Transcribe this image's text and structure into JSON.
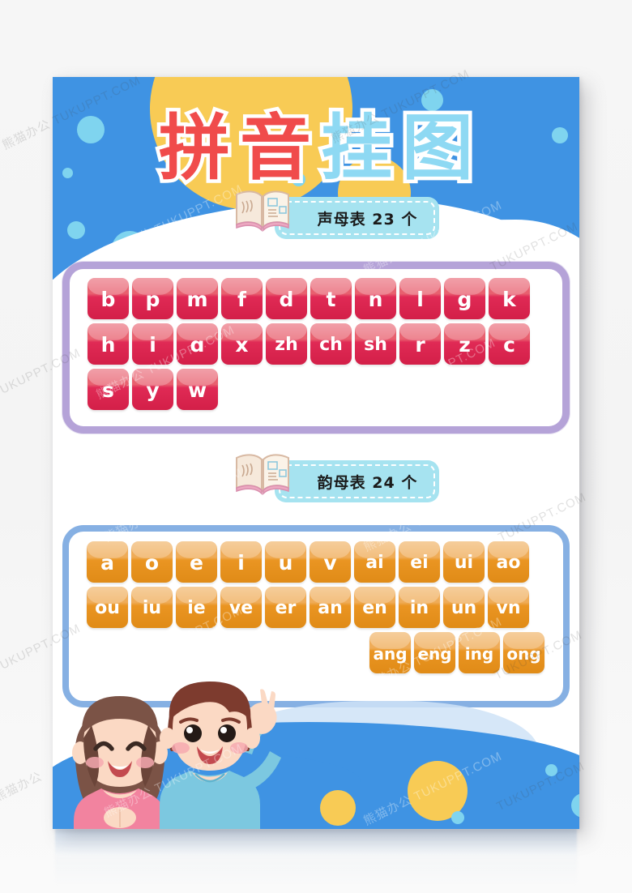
{
  "poster": {
    "title_chars": [
      "拼",
      "音",
      "挂",
      "图"
    ],
    "title_text": "拼音挂图",
    "title_colors": {
      "first_pair": "#f04b4b",
      "second_pair": "#8ed9f3",
      "outline": "#ffffff"
    }
  },
  "sections": [
    {
      "id": "shengmu",
      "badge_label": "声母表  23  个",
      "badge_icon": "open-book-icon",
      "count": 23,
      "key_color": "#e02a55",
      "panel_border": "#b5a3d8",
      "rows": [
        [
          "b",
          "p",
          "m",
          "f",
          "d",
          "t",
          "n",
          "l",
          "g",
          "k"
        ],
        [
          "h",
          "i",
          "ɑ",
          "x",
          "zh",
          "ch",
          "sh",
          "r",
          "z",
          "c"
        ],
        [
          "s",
          "y",
          "w"
        ]
      ]
    },
    {
      "id": "yunmu",
      "badge_label": "韵母表  24  个",
      "badge_icon": "open-book-icon",
      "count": 24,
      "key_color": "#ea9522",
      "panel_border": "#86b0e3",
      "rows": [
        [
          "a",
          "o",
          "e",
          "i",
          "u",
          "v",
          "ai",
          "ei",
          "ui",
          "ao"
        ],
        [
          "ou",
          "iu",
          "ie",
          "ve",
          "er",
          "an",
          "en",
          "in",
          "un",
          "vn"
        ],
        [
          "ang",
          "eng",
          "ing",
          "ong"
        ]
      ],
      "last_row_align": "right"
    }
  ],
  "decor": {
    "header_bg": "#3f93e3",
    "sun_color": "#f8cb55",
    "bubble_color": "#7fd4ef",
    "footer_bg": "#3f93e3",
    "girl_shirt": "#f2839f",
    "girl_hair": "#7b5346",
    "boy_shirt": "#7cc8e0",
    "boy_hair": "#7d3b2e",
    "skin": "#fbd9c4"
  },
  "watermarks": {
    "text_a": "熊猫办公 TUKUPPT.COM",
    "text_b": "TUKUPPT.COM",
    "text_c": "熊猫办公"
  }
}
